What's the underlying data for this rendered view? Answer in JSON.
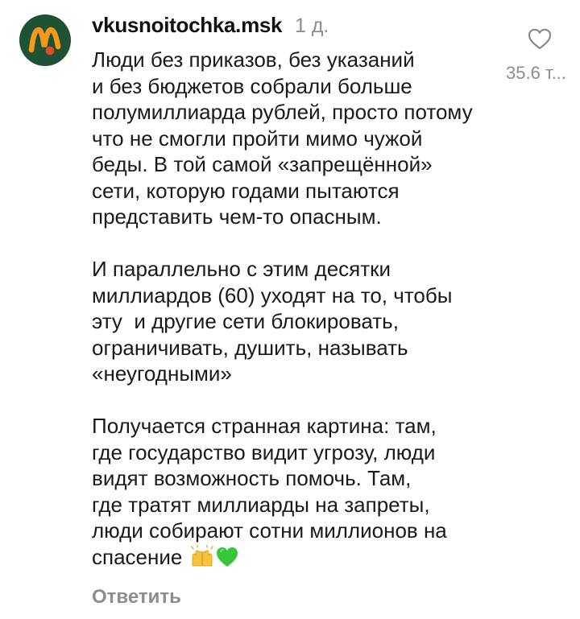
{
  "comment": {
    "username": "vkusnoitochka.msk",
    "time_ago": "1 д.",
    "avatar_icon": "brand-logo-icon",
    "colors": {
      "avatar_bg": "#1f5135",
      "logo_orange": "#f39a1b",
      "logo_red": "#e14a2a",
      "muted_text": "#8d8d8d",
      "heart_emoji": "#37c53a"
    },
    "paragraphs": [
      {
        "lines": [
          "Люди без приказов, без указаний",
          "и без бюджетов собрали больше",
          "полумиллиарда рублей, просто потому",
          "что не смогли пройти мимо чужой",
          "беды. В той самой «запрещённой»",
          "сети, которую годами пытаются",
          "представить чем-то опасным."
        ]
      },
      {
        "lines": [
          "И параллельно с этим десятки",
          "миллиардов (60) уходят на то, чтобы",
          "эту  и другие сети блокировать,",
          "ограничивать, душить, называть",
          "«неугодными»"
        ]
      },
      {
        "lines": [
          "Получается странная картина: там,",
          "где государство видит угрозу, люди",
          "видят возможность помочь. Там,",
          "где тратят миллиарды на запреты,",
          "люди собирают сотни миллионов на",
          "спасение"
        ],
        "trailing_emojis": [
          "raising-hands-emoji",
          "green-heart-emoji"
        ]
      }
    ],
    "likes_count": "35.6 т...",
    "like_icon": "heart-outline-icon",
    "reply_label": "Ответить"
  }
}
